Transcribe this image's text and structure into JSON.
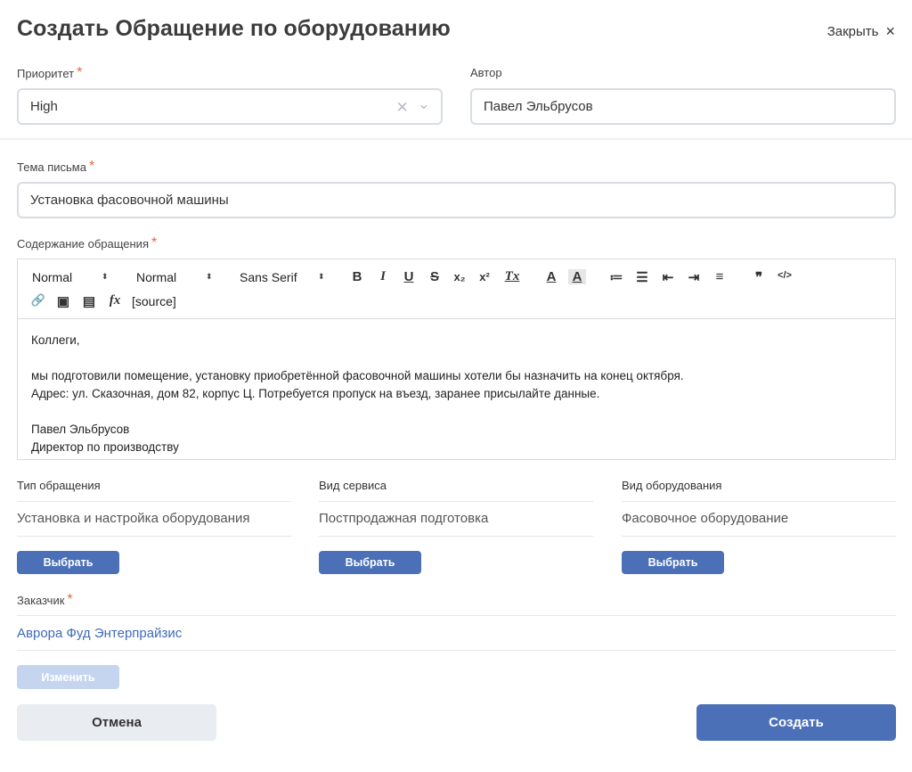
{
  "dialog": {
    "title": "Создать Обращение по оборудованию",
    "close_label": "Закрыть",
    "close_icon": "×"
  },
  "priority": {
    "label": "Приоритет",
    "required_mark": "*",
    "value": "High",
    "clear_icon": "✕",
    "chevron_icon": "⌄"
  },
  "author": {
    "label": "Автор",
    "value": "Павел Эльбрусов"
  },
  "subject": {
    "label": "Тема письма",
    "required_mark": "*",
    "value": "Установка фасовочной машины"
  },
  "body": {
    "label": "Содержание обращения",
    "required_mark": "*",
    "toolbar": {
      "size_value": "Normal",
      "header_value": "Normal",
      "font_value": "Sans Serif",
      "dropdown_arrow": "⬍",
      "bold": "B",
      "italic": "I",
      "underline": "U",
      "strike": "S",
      "subscript": "x₂",
      "superscript": "x²",
      "clean": "Tx",
      "color": "A",
      "background": "A",
      "ordered_list": "≔",
      "bullet_list": "☰",
      "outdent": "⇤",
      "indent": "⇥",
      "align": "≡",
      "blockquote": "❞",
      "code": "</>",
      "link": "🔗",
      "image": "▣",
      "video": "▤",
      "formula": "fx",
      "source": "[source]"
    },
    "lines": [
      "Коллеги,",
      "",
      "мы подготовили помещение, установку приобретённой фасовочной машины хотели бы назначить на конец октября.",
      "Адрес: ул. Сказочная, дом 82, корпус Ц. Потребуется пропуск на въезд, заранее присылайте данные.",
      "",
      "Павел Эльбрусов",
      "Директор по производству"
    ]
  },
  "columns": [
    {
      "label": "Тип обращения",
      "value": "Установка и настройка оборудования",
      "button": "Выбрать"
    },
    {
      "label": "Вид сервиса",
      "value": "Постпродажная подготовка",
      "button": "Выбрать"
    },
    {
      "label": "Вид оборудования",
      "value": "Фасовочное оборудование",
      "button": "Выбрать"
    }
  ],
  "customer": {
    "label": "Заказчик",
    "required_mark": "*",
    "value": "Аврора Фуд Энтерпрайзис",
    "change_button": "Изменить"
  },
  "footer": {
    "cancel": "Отмена",
    "create": "Создать"
  }
}
